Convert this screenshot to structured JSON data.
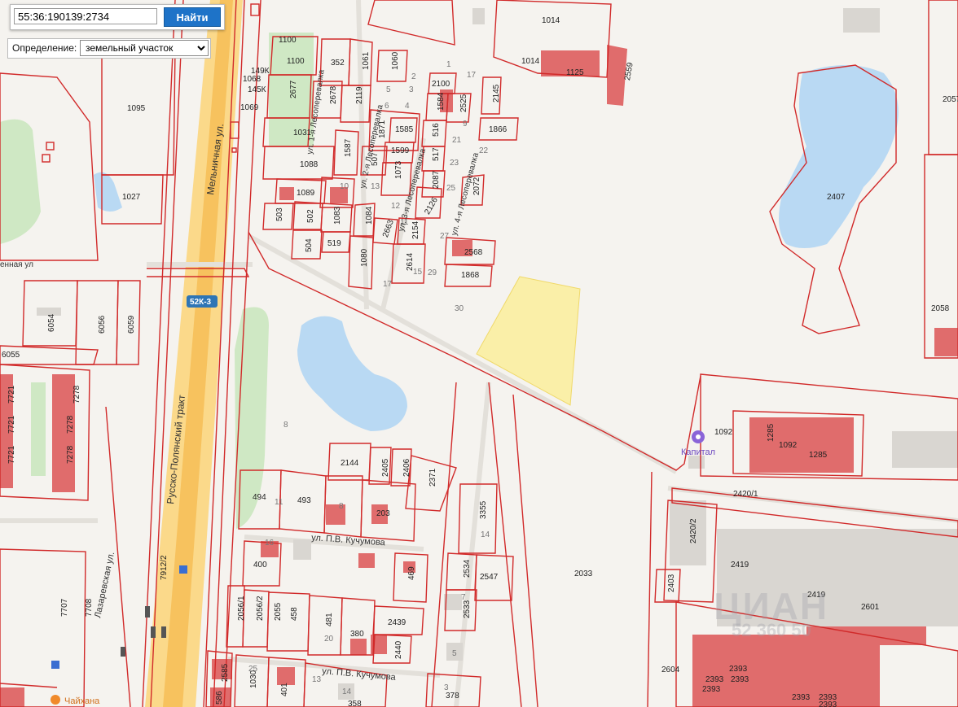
{
  "search": {
    "value": "55:36:190139:2734",
    "button_label": "Найти"
  },
  "definition": {
    "label": "Определение:",
    "selected": "земельный участок",
    "options": [
      "земельный участок"
    ]
  },
  "streets": {
    "melnichnaya": "Мельничная ул.",
    "russko_polyansky": "Русско-Полянский тракт",
    "lesoperevalka_1": "ул. 1-я Лесоперевалка",
    "lesoperevalka_2": "ул. 2-я Лесоперевалка",
    "lesoperevalka_3": "ул. 3-я Лесоперевалка",
    "lesoperevalka_4": "ул. 4-я Лесоперевалка",
    "kuchumova_1": "ул. П.В. Кучумова",
    "kuchumova_2": "ул. П.В. Кучумова",
    "lazarevskaya": "Лазаревская ул.",
    "edge_street": "енная ул"
  },
  "road_badge": "52К-3",
  "poi": {
    "kapital": "Капитал",
    "chaihana": "Чайхана"
  },
  "watermark": {
    "brand": "ЦИАН",
    "phone": "52 360 50"
  },
  "colors": {
    "parcel_border": "#d12a2a",
    "building": "#e06c6c",
    "water": "#b9d9f3",
    "park": "#cfe8c4",
    "highlight": "#fbeea0",
    "road": "#f7c25e",
    "search_button": "#1e73c8"
  },
  "parcel_labels": [
    "1100",
    "1100",
    "352",
    "1061",
    "1060",
    "149К",
    "1068",
    "145К",
    "1069",
    "1095",
    "2677",
    "2678",
    "2119",
    "2100",
    "1584",
    "2525",
    "2145",
    "1866",
    "1031",
    "1585",
    "516",
    "1871",
    "1587",
    "1599",
    "507",
    "517",
    "1088",
    "1073",
    "2087",
    "2072",
    "1089",
    "1027",
    "2126",
    "503",
    "502",
    "1083",
    "1084",
    "2663",
    "2154",
    "504",
    "519",
    "1080",
    "2614",
    "2568",
    "1868",
    "6054",
    "6056",
    "6059",
    "6055",
    "7721",
    "7721",
    "7721",
    "7278",
    "7278",
    "7278",
    "1014",
    "1014",
    "1125",
    "2559",
    "2057",
    "2407",
    "2058",
    "1092",
    "1285",
    "1092",
    "1285",
    "2144",
    "2405",
    "2406",
    "494",
    "493",
    "203",
    "2371",
    "3355",
    "2420/1",
    "2420/2",
    "400",
    "469",
    "2534",
    "2547",
    "2033",
    "2419",
    "2419",
    "2601",
    "2403",
    "2056/1",
    "2056/2",
    "2055",
    "458",
    "481",
    "380",
    "2439",
    "2440",
    "2533",
    "2604",
    "2393",
    "2393",
    "2393",
    "2393",
    "2393",
    "2393",
    "2393",
    "1030",
    "401",
    "358",
    "378",
    "2585",
    "586",
    "7912/2",
    "7707",
    "7708"
  ],
  "house_numbers": [
    "1",
    "2",
    "17",
    "5",
    "3",
    "6",
    "4",
    "9",
    "21",
    "22",
    "23",
    "25",
    "10",
    "13",
    "12",
    "11",
    "27",
    "29",
    "30",
    "15",
    "17",
    "8",
    "8",
    "11",
    "16",
    "14",
    "7",
    "5",
    "20",
    "25",
    "13",
    "14",
    "3"
  ]
}
